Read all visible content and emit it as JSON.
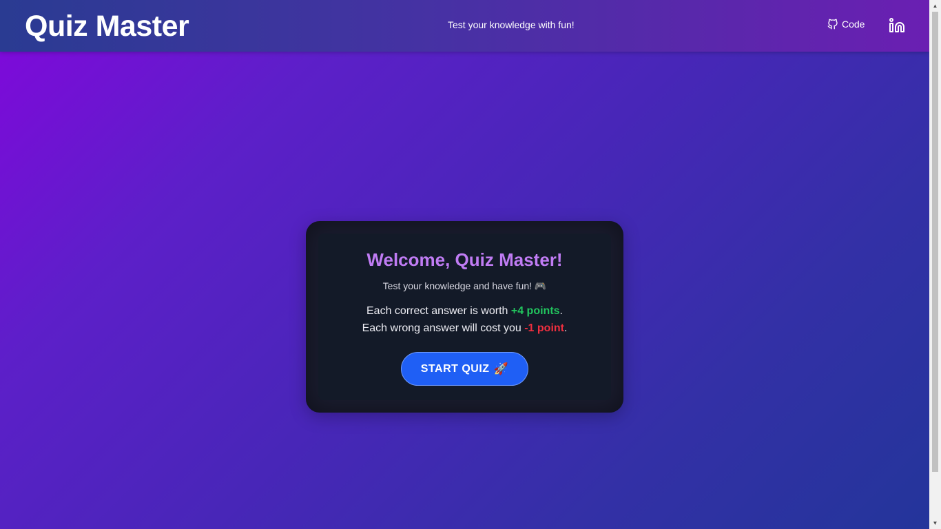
{
  "header": {
    "brand": "Quiz Master",
    "tagline": "Test your knowledge with fun!",
    "code_label": "Code",
    "code_icon": "github-icon",
    "linkedin_icon": "linkedin-icon"
  },
  "card": {
    "title": "Welcome, Quiz Master!",
    "subtitle": "Test your knowledge and have fun! 🎮",
    "rule_correct_prefix": "Each correct answer is worth ",
    "rule_correct_points": "+4 points",
    "rule_correct_suffix": ".",
    "rule_wrong_prefix": "Each wrong answer will cost you ",
    "rule_wrong_points": "-1 point",
    "rule_wrong_suffix": ".",
    "start_label": "START QUIZ",
    "start_icon": "🚀"
  },
  "colors": {
    "title": "#c07cf4",
    "positive": "#22c55e",
    "negative": "#ef2f3f",
    "button": "#1f5ff5",
    "card_bg": "#1a1c2e"
  }
}
